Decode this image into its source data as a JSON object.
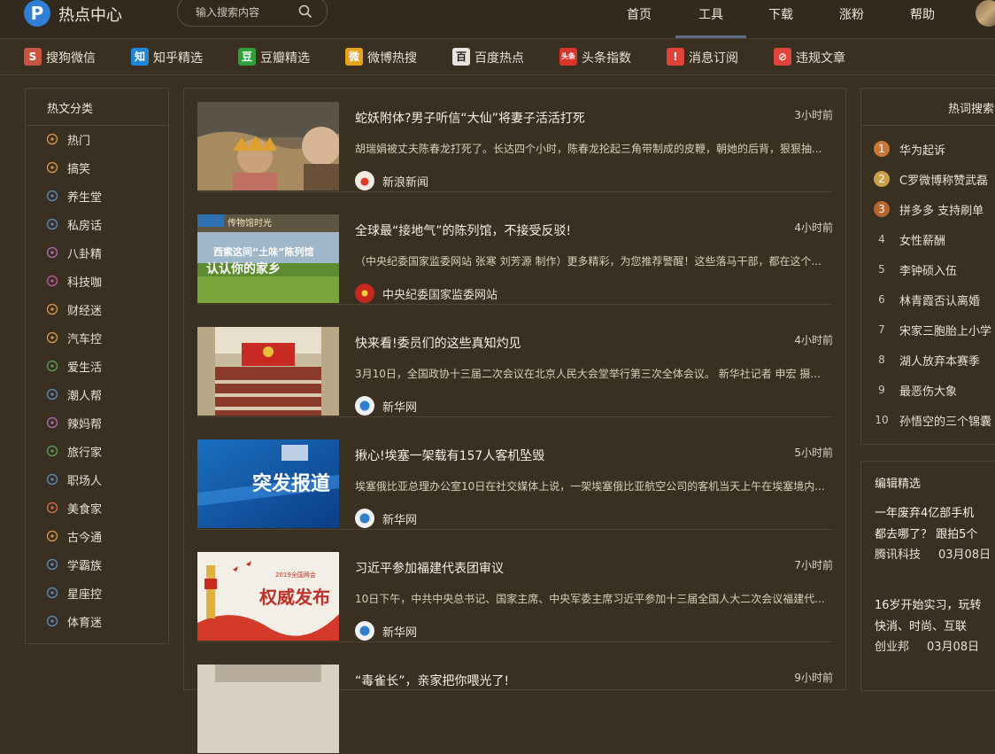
{
  "header": {
    "logo_letter": "P",
    "title": "热点中心",
    "search_placeholder": "输入搜索内容",
    "nav": [
      "首页",
      "工具",
      "下载",
      "涨粉",
      "帮助"
    ],
    "active_nav": "工具"
  },
  "sources": [
    {
      "label": "搜狗微信",
      "icon": "sogou-icon",
      "glyph": "S",
      "color": "#c8553d"
    },
    {
      "label": "知乎精选",
      "icon": "zhihu-icon",
      "glyph": "知",
      "color": "#1f86d8"
    },
    {
      "label": "豆瓣精选",
      "icon": "douban-icon",
      "glyph": "豆",
      "color": "#2ea03a"
    },
    {
      "label": "微博热搜",
      "icon": "weibo-icon",
      "glyph": "微",
      "color": "#e6a21a"
    },
    {
      "label": "百度热点",
      "icon": "baidu-icon",
      "glyph": "百",
      "color": "#e8e4dc"
    },
    {
      "label": "头条指数",
      "icon": "toutiao-icon",
      "glyph": "头条",
      "color": "#d9342b"
    },
    {
      "label": "消息订阅",
      "icon": "subscribe-icon",
      "glyph": "!",
      "color": "#e0433a"
    },
    {
      "label": "违规文章",
      "icon": "forbidden-icon",
      "glyph": "⊘",
      "color": "#e0433a"
    }
  ],
  "categories": {
    "title": "热文分类",
    "items": [
      {
        "label": "热门",
        "icon": "clock-icon"
      },
      {
        "label": "搞笑",
        "icon": "smile-icon"
      },
      {
        "label": "养生堂",
        "icon": "building-icon"
      },
      {
        "label": "私房话",
        "icon": "compass-icon"
      },
      {
        "label": "八卦精",
        "icon": "film-reel-icon"
      },
      {
        "label": "科技咖",
        "icon": "camera-icon"
      },
      {
        "label": "财经迷",
        "icon": "coin-icon"
      },
      {
        "label": "汽车控",
        "icon": "car-icon"
      },
      {
        "label": "爱生活",
        "icon": "plant-icon"
      },
      {
        "label": "潮人帮",
        "icon": "tie-icon"
      },
      {
        "label": "辣妈帮",
        "icon": "shoe-icon"
      },
      {
        "label": "旅行家",
        "icon": "luggage-icon"
      },
      {
        "label": "职场人",
        "icon": "gauge-icon"
      },
      {
        "label": "美食家",
        "icon": "bowl-icon"
      },
      {
        "label": "古今通",
        "icon": "target-icon"
      },
      {
        "label": "学霸族",
        "icon": "pen-icon"
      },
      {
        "label": "星座控",
        "icon": "star-sign-icon"
      },
      {
        "label": "体育迷",
        "icon": "ball-icon"
      }
    ]
  },
  "articles": [
    {
      "title": "蛇妖附体?男子听信“大仙”将妻子活活打死",
      "time": "3小时前",
      "summary": "胡瑞娟被丈夫陈春龙打死了。长达四个小时，陈春龙抡起三角带制成的皮鞭，朝她的后背，狠狠抽...",
      "source": "新浪新闻"
    },
    {
      "title": "全球最“接地气”的陈列馆，不接受反驳!",
      "time": "4小时前",
      "summary": "（中央纪委国家监委网站 张寒 刘芳源 制作）更多精彩，为您推荐警醒！这些落马干部，都在这个...",
      "source": "中央纪委国家监委网站",
      "thumb_text": [
        "传物馆时光",
        "西索这间“土味”陈列馆",
        "认认你的家乡"
      ]
    },
    {
      "title": "快来看!委员们的这些真知灼见",
      "time": "4小时前",
      "summary": "3月10日，全国政协十三届二次会议在北京人民大会堂举行第三次全体会议。 新华社记者 申宏 摄...",
      "source": "新华网"
    },
    {
      "title": "揪心!埃塞一架载有157人客机坠毁",
      "time": "5小时前",
      "summary": "埃塞俄比亚总理办公室10日在社交媒体上说，一架埃塞俄比亚航空公司的客机当天上午在埃塞境内...",
      "source": "新华网",
      "thumb_text": [
        "突发报道"
      ]
    },
    {
      "title": "习近平参加福建代表团审议",
      "time": "7小时前",
      "summary": "10日下午，中共中央总书记、国家主席、中央军委主席习近平参加十三届全国人大二次会议福建代...",
      "source": "新华网",
      "thumb_text": [
        "2019全国两会",
        "权威发布"
      ]
    },
    {
      "title": "“毒雀长”，亲家把你喂光了!",
      "time": "9小时前",
      "summary": "",
      "source": ""
    }
  ],
  "hot_words": {
    "title": "热词搜索",
    "items": [
      {
        "rank": "1",
        "word": "华为起诉",
        "color": "#c9763a"
      },
      {
        "rank": "2",
        "word": "C罗微博称赞武磊",
        "color": "#c8a04a"
      },
      {
        "rank": "3",
        "word": "拼多多 支持刷单",
        "color": "#b9652f"
      },
      {
        "rank": "4",
        "word": "女性薪酬"
      },
      {
        "rank": "5",
        "word": "李钟硕入伍"
      },
      {
        "rank": "6",
        "word": "林青霞否认离婚"
      },
      {
        "rank": "7",
        "word": "宋家三胞胎上小学"
      },
      {
        "rank": "8",
        "word": "湖人放弃本赛季"
      },
      {
        "rank": "9",
        "word": "最恶伤大象"
      },
      {
        "rank": "10",
        "word": "孙悟空的三个锦囊"
      }
    ]
  },
  "editor_picks": {
    "title": "编辑精选",
    "items": [
      {
        "title_lines": [
          "一年废弃4亿部手机",
          "都去哪了？ 跟拍5个"
        ],
        "source": "腾讯科技",
        "date": "03月08日"
      },
      {
        "title_lines": [
          "16岁开始实习，玩转",
          "快消、时尚、互联"
        ],
        "source": "创业邦",
        "date": "03月08日"
      }
    ]
  }
}
